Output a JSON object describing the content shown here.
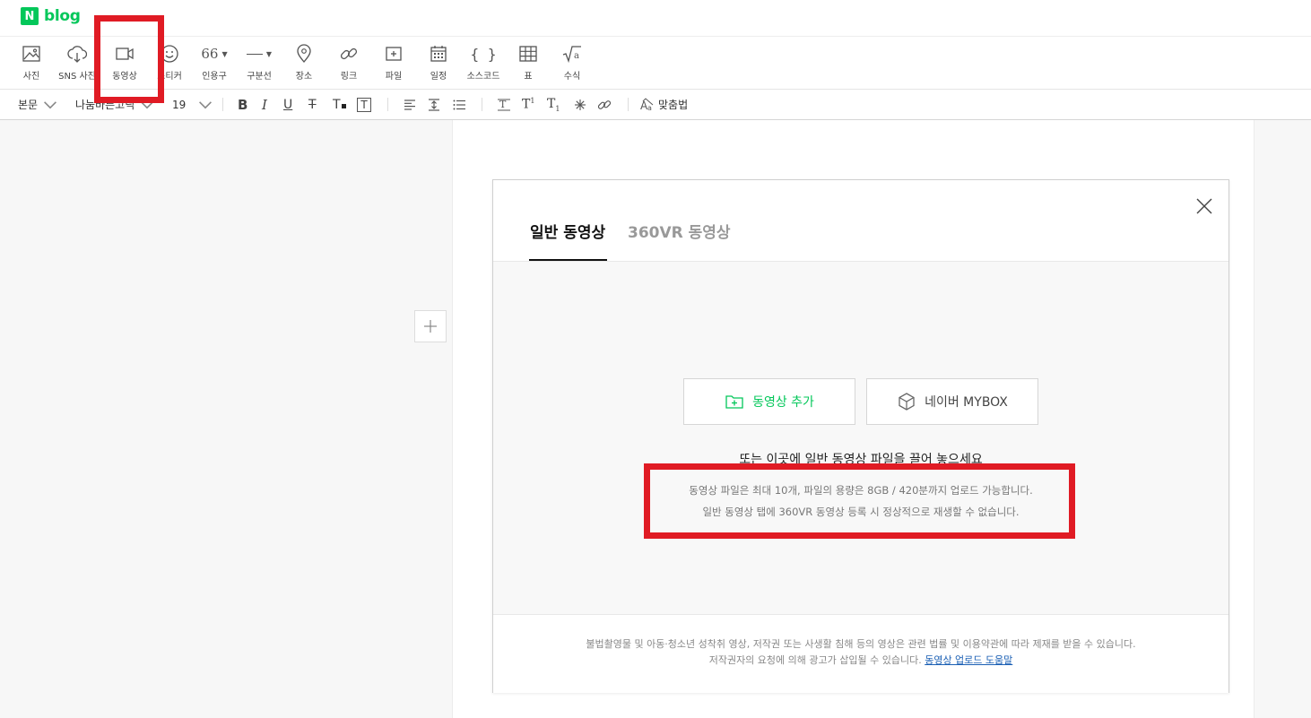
{
  "header": {
    "logo_letter": "N",
    "logo_text": "blog"
  },
  "insert_toolbar": {
    "items": [
      {
        "label": "사진",
        "icon": "image-icon"
      },
      {
        "label": "SNS 사진",
        "icon": "cloud-download-icon"
      },
      {
        "label": "동영상",
        "icon": "video-camera-icon"
      },
      {
        "label": "스티커",
        "icon": "smiley-icon"
      },
      {
        "label": "인용구",
        "icon": "quote-icon"
      },
      {
        "label": "구분선",
        "icon": "divider-line-icon"
      },
      {
        "label": "장소",
        "icon": "map-pin-icon"
      },
      {
        "label": "링크",
        "icon": "link-icon"
      },
      {
        "label": "파일",
        "icon": "file-add-icon"
      },
      {
        "label": "일정",
        "icon": "calendar-icon"
      },
      {
        "label": "소스코드",
        "icon": "braces-icon"
      },
      {
        "label": "표",
        "icon": "table-grid-icon"
      },
      {
        "label": "수식",
        "icon": "square-root-icon"
      }
    ],
    "quote_glyph": "66"
  },
  "format_toolbar": {
    "style_select": "본문",
    "font_select": "나눔바른고딕",
    "size_select": "19",
    "spellcheck_label": "맞춤법"
  },
  "dialog": {
    "tabs": [
      "일반 동영상",
      "360VR 동영상"
    ],
    "active_tab": 0,
    "add_button": "동영상 추가",
    "mybox_button": "네이버 MYBOX",
    "drop_text": "또는 이곳에 일반 동영상 파일을 끌어 놓으세요",
    "info_line1": "동영상 파일은 최대 10개, 파일의 용량은 8GB / 420분까지 업로드 가능합니다.",
    "info_line2": "일반 동영상 탭에 360VR 동영상 등록 시 정상적으로 재생할 수 없습니다.",
    "footer_line1": "불법촬영물 및 아동·청소년 성착취 영상, 저작권 또는 사생활 침해 등의 영상은 관련 법률 및 이용약관에 따라 제재를 받을 수 있습니다.",
    "footer_line2": "저작권자의 요청에 의해 광고가 삽입될 수 있습니다.",
    "footer_link": "동영상 업로드 도움말"
  },
  "colors": {
    "brand_green": "#03c75a",
    "highlight_red": "#e01b24",
    "link_blue": "#1a5fb4"
  }
}
